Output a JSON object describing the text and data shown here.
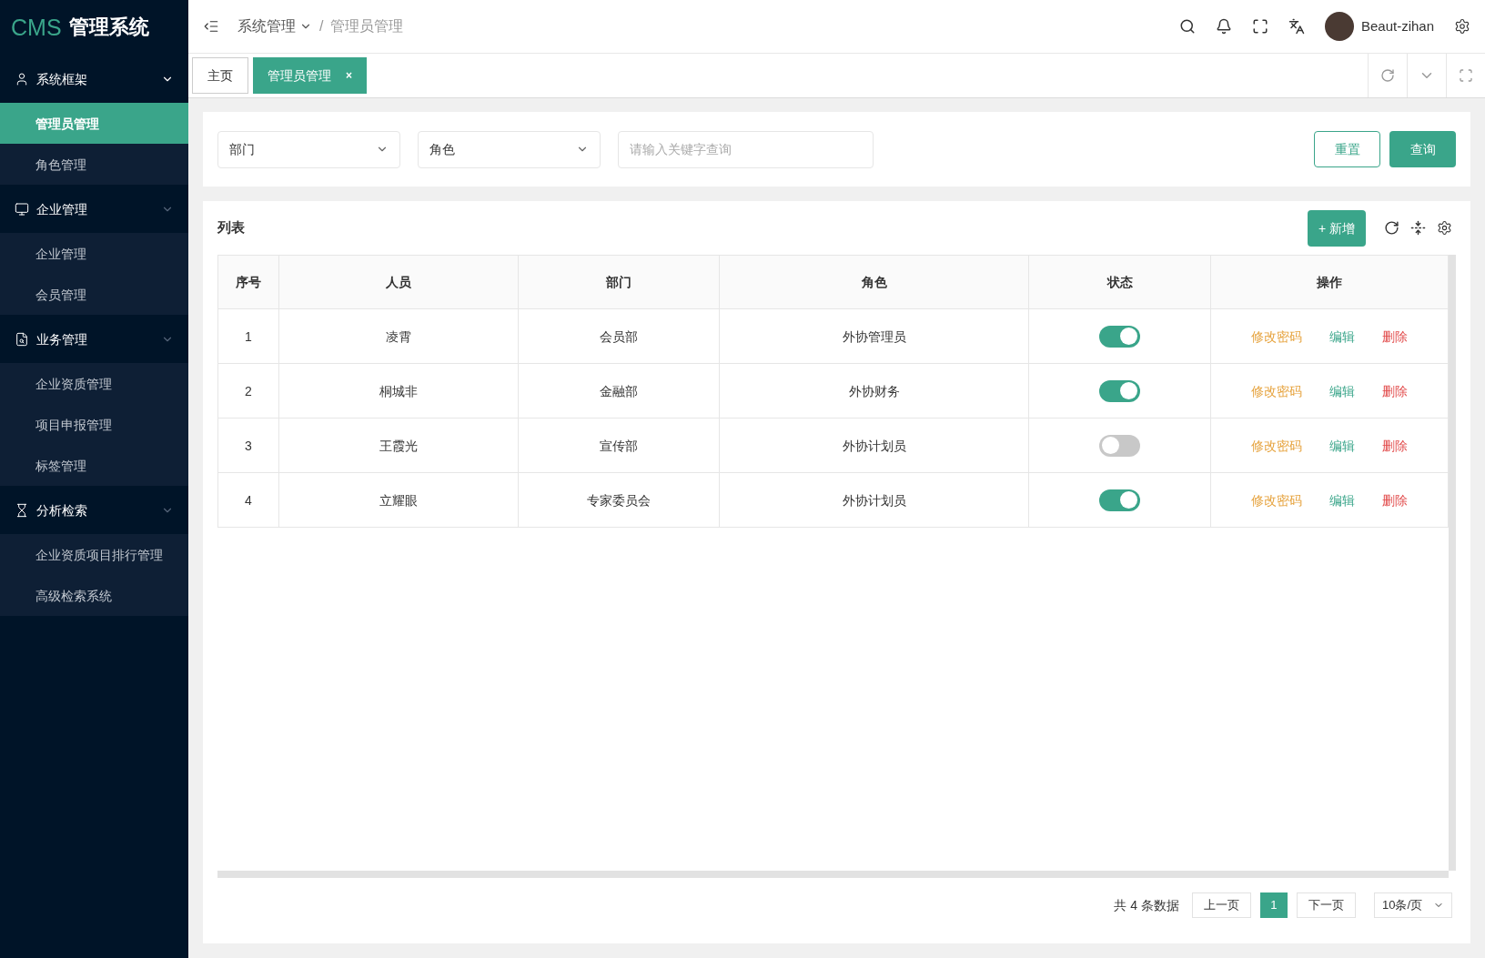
{
  "logo": {
    "brand": "CMS",
    "title": "管理系统"
  },
  "sidebar": {
    "groups": [
      {
        "label": "系统框架",
        "expanded": true,
        "items": [
          {
            "label": "管理员管理",
            "selected": true
          },
          {
            "label": "角色管理",
            "selected": false
          }
        ]
      },
      {
        "label": "企业管理",
        "expanded": true,
        "items": [
          {
            "label": "企业管理",
            "selected": false
          },
          {
            "label": "会员管理",
            "selected": false
          }
        ]
      },
      {
        "label": "业务管理",
        "expanded": true,
        "items": [
          {
            "label": "企业资质管理",
            "selected": false
          },
          {
            "label": "项目申报管理",
            "selected": false
          },
          {
            "label": "标签管理",
            "selected": false
          }
        ]
      },
      {
        "label": "分析检索",
        "expanded": true,
        "items": [
          {
            "label": "企业资质项目排行管理",
            "selected": false
          },
          {
            "label": "高级检索系统",
            "selected": false
          }
        ]
      }
    ]
  },
  "breadcrumb": {
    "items": [
      "系统管理",
      "管理员管理"
    ],
    "separator": "/"
  },
  "user": {
    "name": "Beaut-zihan"
  },
  "tabs": [
    {
      "label": "主页",
      "selected": false,
      "closable": false
    },
    {
      "label": "管理员管理",
      "selected": true,
      "closable": true
    }
  ],
  "tab_close": "×",
  "filters": {
    "department": {
      "placeholder": "部门"
    },
    "role": {
      "placeholder": "角色"
    },
    "keyword": {
      "placeholder": "请输入关键字查询"
    },
    "reset": "重置",
    "search": "查询"
  },
  "list": {
    "title": "列表",
    "add": "+ 新增"
  },
  "table": {
    "columns": [
      "序号",
      "人员",
      "部门",
      "角色",
      "状态",
      "操作"
    ],
    "rows": [
      {
        "index": "1",
        "name": "凌霄",
        "department": "会员部",
        "role": "外协管理员",
        "on": true,
        "actions": [
          {
            "label": "修改密码",
            "kind": "password"
          },
          {
            "label": "编辑",
            "kind": "edit"
          },
          {
            "label": "删除",
            "kind": "delete"
          }
        ]
      },
      {
        "index": "2",
        "name": "桐城非",
        "department": "金融部",
        "role": "外协财务",
        "on": true,
        "actions": [
          {
            "label": "修改密码",
            "kind": "password"
          },
          {
            "label": "编辑",
            "kind": "edit"
          },
          {
            "label": "删除",
            "kind": "delete"
          }
        ]
      },
      {
        "index": "3",
        "name": "王霞光",
        "department": "宣传部",
        "role": "外协计划员",
        "on": false,
        "actions": [
          {
            "label": "修改密码",
            "kind": "password"
          },
          {
            "label": "编辑",
            "kind": "edit"
          },
          {
            "label": "删除",
            "kind": "delete"
          }
        ]
      },
      {
        "index": "4",
        "name": "立耀眼",
        "department": "专家委员会",
        "role": "外协计划员",
        "on": true,
        "actions": [
          {
            "label": "修改密码",
            "kind": "password"
          },
          {
            "label": "编辑",
            "kind": "edit"
          },
          {
            "label": "删除",
            "kind": "delete"
          }
        ]
      }
    ]
  },
  "pagination": {
    "total": "共 4 条数据",
    "prev": "上一页",
    "pages": [
      {
        "label": "1",
        "selected": true
      }
    ],
    "next": "下一页",
    "page_size": "10条/页"
  }
}
